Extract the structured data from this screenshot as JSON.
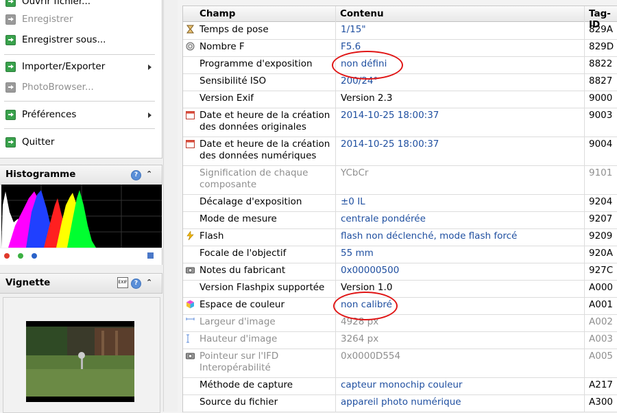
{
  "menu": {
    "items": [
      {
        "label": "Ouvrir fichier...",
        "disabled": false,
        "submenu": false
      },
      {
        "label": "Enregistrer",
        "disabled": true,
        "submenu": false
      },
      {
        "label": "Enregistrer sous...",
        "disabled": false,
        "submenu": false
      },
      {
        "label": "Importer/Exporter",
        "disabled": false,
        "submenu": true
      },
      {
        "label": "PhotoBrowser...",
        "disabled": true,
        "submenu": false
      },
      {
        "label": "Préférences",
        "disabled": false,
        "submenu": true
      },
      {
        "label": "Quitter",
        "disabled": false,
        "submenu": false
      }
    ]
  },
  "histogram": {
    "title": "Histogramme",
    "channel_dots": [
      "#e0392b",
      "#3cb043",
      "#2a62c9"
    ]
  },
  "thumbnail": {
    "title": "Vignette"
  },
  "table": {
    "headers": [
      "Champ",
      "Contenu",
      "Tag-ID"
    ],
    "rows": [
      {
        "icon": "hourglass-icon",
        "field": "Temps de pose",
        "value": "1/15\"",
        "tag": "829A"
      },
      {
        "icon": "aperture-icon",
        "field": "Nombre F",
        "value": "F5.6",
        "tag": "829D"
      },
      {
        "icon": "",
        "field": "Programme d'exposition",
        "value": "non défini",
        "tag": "8822"
      },
      {
        "icon": "",
        "field": "Sensibilité ISO",
        "value": "200/24°",
        "tag": "8827"
      },
      {
        "icon": "",
        "field": "Version Exif",
        "value": "Version 2.3",
        "tag": "9000"
      },
      {
        "icon": "calendar-icon",
        "field": "Date et heure de la création des données originales",
        "value": "2014-10-25 18:00:37",
        "tag": "9003"
      },
      {
        "icon": "calendar-icon",
        "field": "Date et heure de la création des données numériques",
        "value": "2014-10-25 18:00:37",
        "tag": "9004"
      },
      {
        "icon": "",
        "field": "Signification de chaque composante",
        "value": "YCbCr",
        "tag": "9101"
      },
      {
        "icon": "",
        "field": "Décalage d'exposition",
        "value": "±0 IL",
        "tag": "9204"
      },
      {
        "icon": "",
        "field": "Mode de mesure",
        "value": "centrale pondérée",
        "tag": "9207"
      },
      {
        "icon": "flash-icon",
        "field": "Flash",
        "value": "flash non déclenché, mode flash forcé",
        "tag": "9209"
      },
      {
        "icon": "",
        "field": "Focale de l'objectif",
        "value": "55 mm",
        "tag": "920A"
      },
      {
        "icon": "camera-icon",
        "field": "Notes du fabricant",
        "value": "0x00000500",
        "tag": "927C"
      },
      {
        "icon": "",
        "field": "Version Flashpix supportée",
        "value": "Version 1.0",
        "tag": "A000"
      },
      {
        "icon": "color-cube-icon",
        "field": "Espace de couleur",
        "value": "non calibré",
        "tag": "A001"
      },
      {
        "icon": "width-icon",
        "field": "Largeur d'image",
        "value": "4928 px",
        "tag": "A002"
      },
      {
        "icon": "height-icon",
        "field": "Hauteur d'image",
        "value": "3264 px",
        "tag": "A003"
      },
      {
        "icon": "camera-icon",
        "field": "Pointeur sur l'IFD Interopérabilité",
        "value": "0x0000D554",
        "tag": "A005"
      },
      {
        "icon": "",
        "field": "Méthode de capture",
        "value": "capteur monochip couleur",
        "tag": "A217"
      },
      {
        "icon": "",
        "field": "Source du fichier",
        "value": "appareil photo numérique",
        "tag": "A300"
      }
    ]
  },
  "colors": {
    "link_value": "#1f4fa0",
    "annotation_circle": "#e01515",
    "dim_text": "#8f8f8f"
  }
}
